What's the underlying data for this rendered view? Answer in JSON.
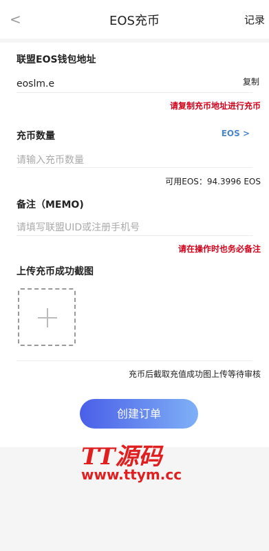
{
  "header": {
    "back_glyph": "<",
    "title": "EOS充币",
    "record_label": "记录"
  },
  "address": {
    "label": "联盟EOS钱包地址",
    "value": "eoslm.e",
    "copy_label": "复制",
    "tip": "请复制充币地址进行充币"
  },
  "amount": {
    "label": "充币数量",
    "unit_selector": "EOS >",
    "placeholder": "请输入充币数量",
    "available": "可用EOS：94.3996 EOS"
  },
  "memo": {
    "label": "备注（MEMO)",
    "placeholder": "请填写联盟UID或注册手机号",
    "tip": "请在操作时也务必备注"
  },
  "upload": {
    "label": "上传充币成功截图"
  },
  "note": "充币后截取充值成功图上传等待审核",
  "submit_label": "创建订单",
  "watermark": {
    "line1": "TT源码",
    "line2": "www.ttym.cc"
  }
}
